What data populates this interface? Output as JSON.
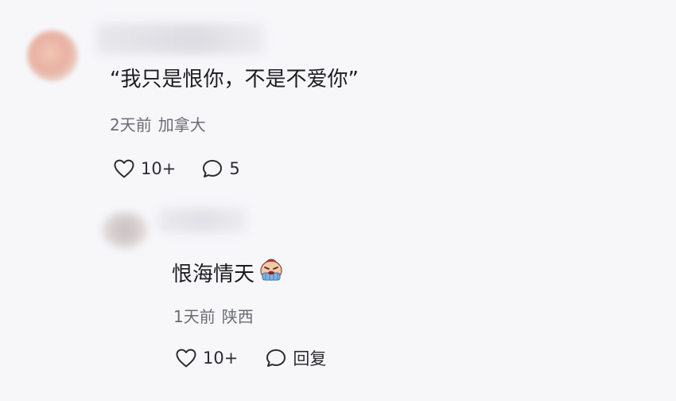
{
  "comment": {
    "text": "“我只是恨你，不是不爱你”",
    "time": "2天前",
    "location": "加拿大",
    "likes": "10+",
    "replies": "5"
  },
  "reply": {
    "text": "恨海情天",
    "emoji": "crying-face-emoji",
    "time": "1天前",
    "location": "陕西",
    "likes": "10+",
    "reply_label": "回复"
  },
  "colors": {
    "text": "#1c1c22",
    "meta": "#6b6b76",
    "icon": "#2b2b33",
    "background": "#f7f7fa"
  }
}
